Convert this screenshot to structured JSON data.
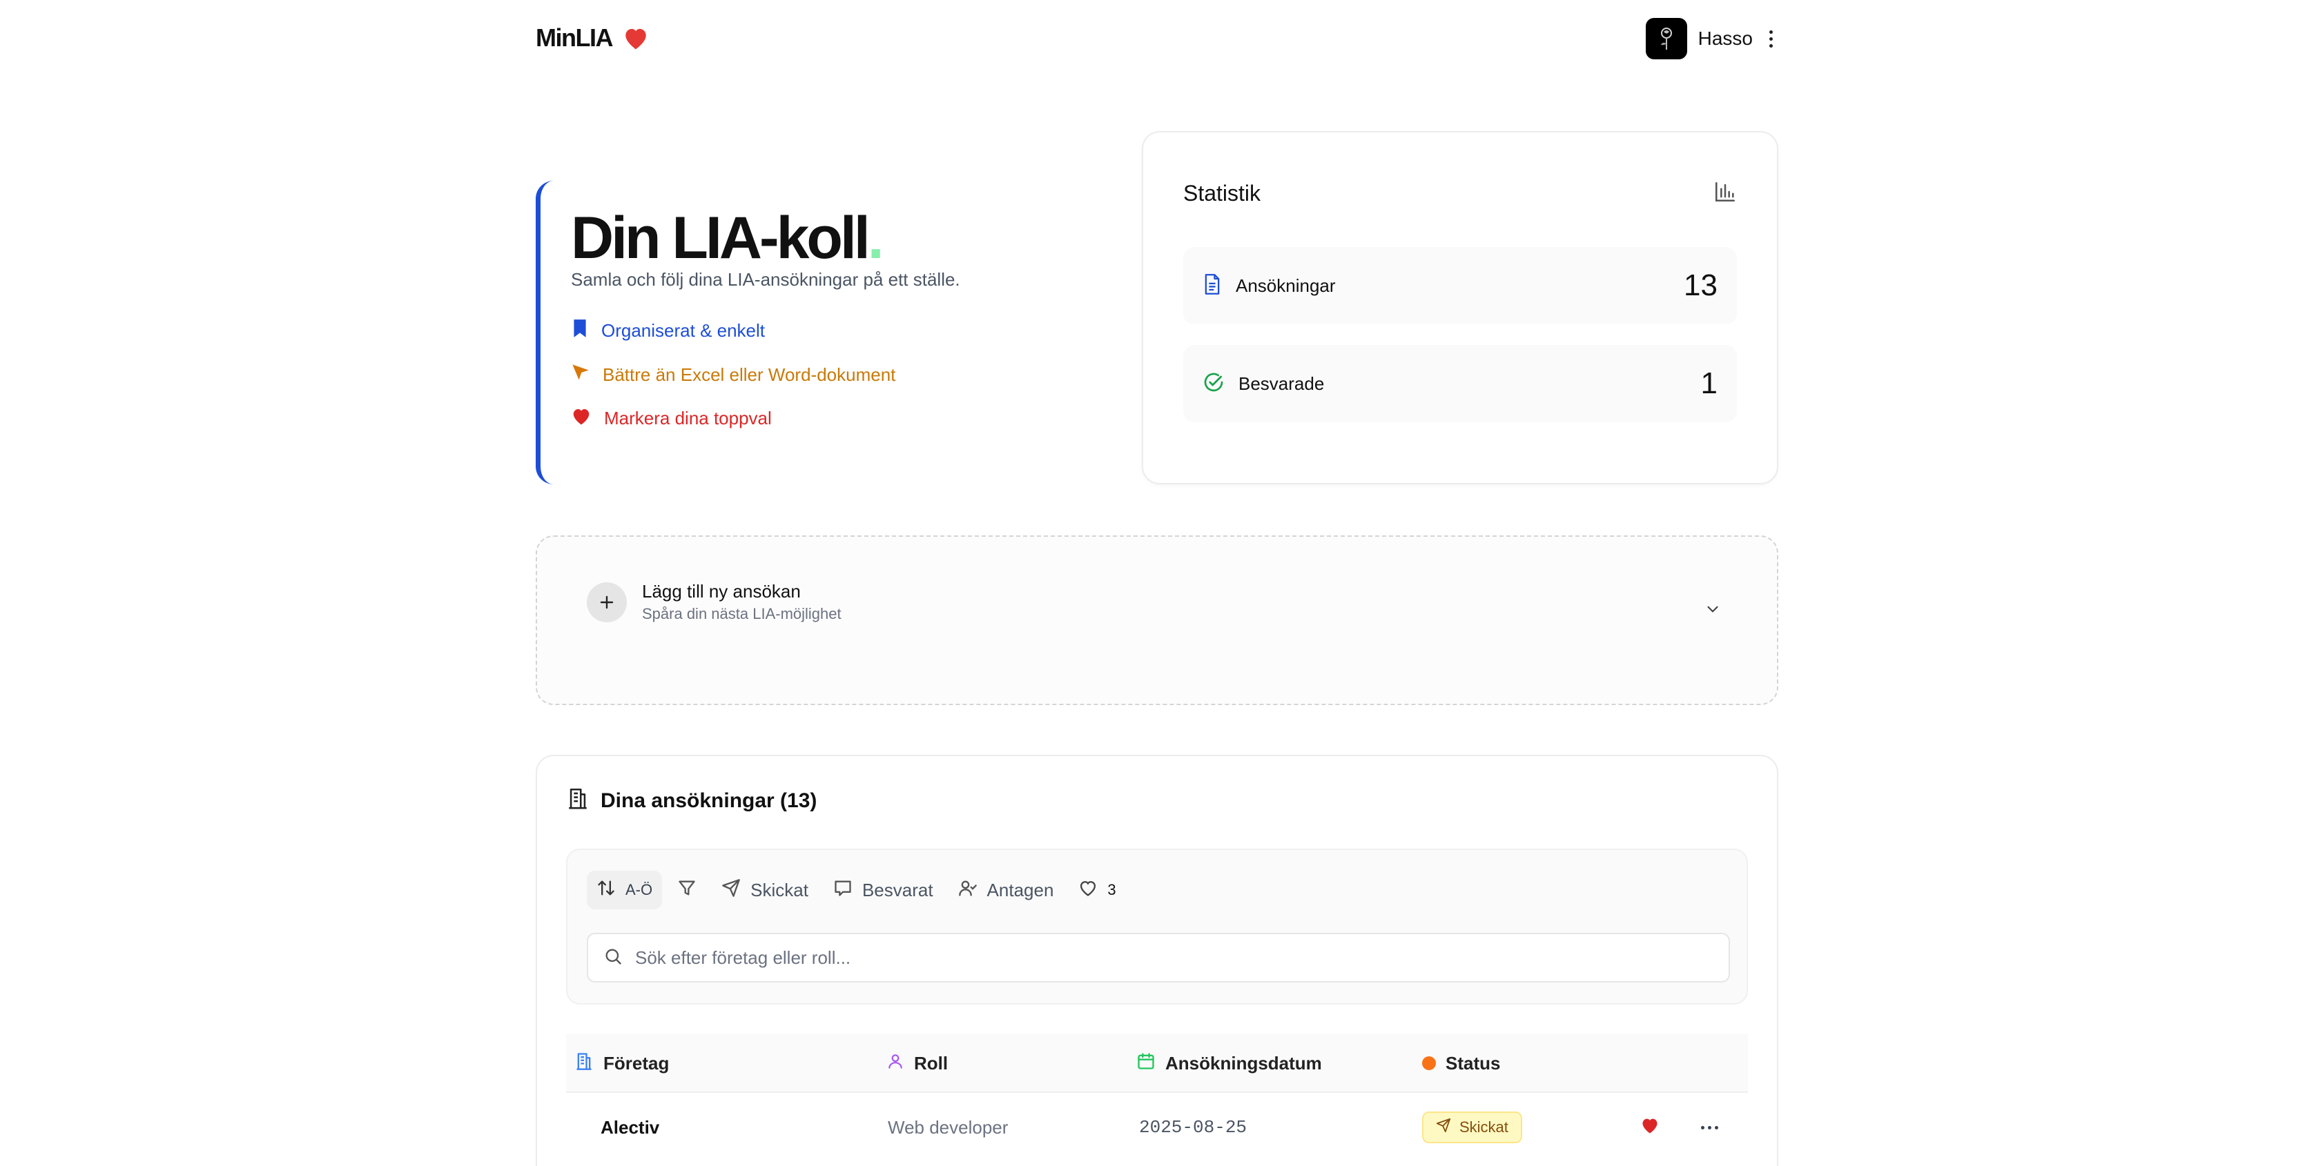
{
  "header": {
    "brand": "MinLIA",
    "user_name": "Hasso"
  },
  "hero": {
    "title": "Din LIA-koll",
    "title_dot": ".",
    "subtitle": "Samla och följ dina LIA-ansökningar på ett ställe.",
    "features": [
      {
        "label": "Organiserat & enkelt",
        "icon": "bookmark-icon",
        "color": "#1d4ed8"
      },
      {
        "label": "Bättre än Excel eller Word-dokument",
        "icon": "cursor-arrow-icon",
        "color": "#c97a08"
      },
      {
        "label": "Markera dina toppval",
        "icon": "heart-icon",
        "color": "#dc2626"
      }
    ]
  },
  "stats": {
    "title": "Statistik",
    "items": [
      {
        "label": "Ansökningar",
        "value": "13",
        "icon": "document-icon"
      },
      {
        "label": "Besvarade",
        "value": "1",
        "icon": "check-circle-icon"
      }
    ]
  },
  "add_panel": {
    "title": "Lägg till ny ansökan",
    "subtitle": "Spåra din nästa LIA-möjlighet"
  },
  "applications": {
    "title": "Dina ansökningar (13)",
    "toolbar": {
      "sort_label": "A-Ö",
      "sent_label": "Skickat",
      "answered_label": "Besvarat",
      "accepted_label": "Antagen",
      "favorites_count": "3"
    },
    "search": {
      "placeholder": "Sök efter företag eller roll...",
      "value": ""
    },
    "columns": {
      "company": "Företag",
      "role": "Roll",
      "date": "Ansökningsdatum",
      "status": "Status"
    },
    "rows": [
      {
        "company": "Alectiv",
        "role": "Web developer",
        "date": "2025-08-25",
        "status": "Skickat",
        "favorite": true
      }
    ]
  },
  "colors": {
    "accent": "#1d4ed8",
    "heart": "#e53935",
    "status_sent_bg": "#fef9c3",
    "status_dot": "#f97316"
  }
}
